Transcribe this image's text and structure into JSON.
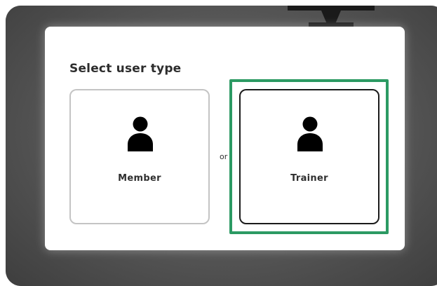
{
  "dialog": {
    "title": "Select user type",
    "separator": "or",
    "options": [
      {
        "label": "Member",
        "icon": "user-icon",
        "selected": false
      },
      {
        "label": "Trainer",
        "icon": "user-icon",
        "selected": true
      }
    ]
  },
  "colors": {
    "overlay": "#4f4f4f",
    "highlight": "#2c9a63",
    "text": "#2d2d2d",
    "card_border": "#c4c4c4",
    "card_border_selected": "#1b1b1b"
  }
}
